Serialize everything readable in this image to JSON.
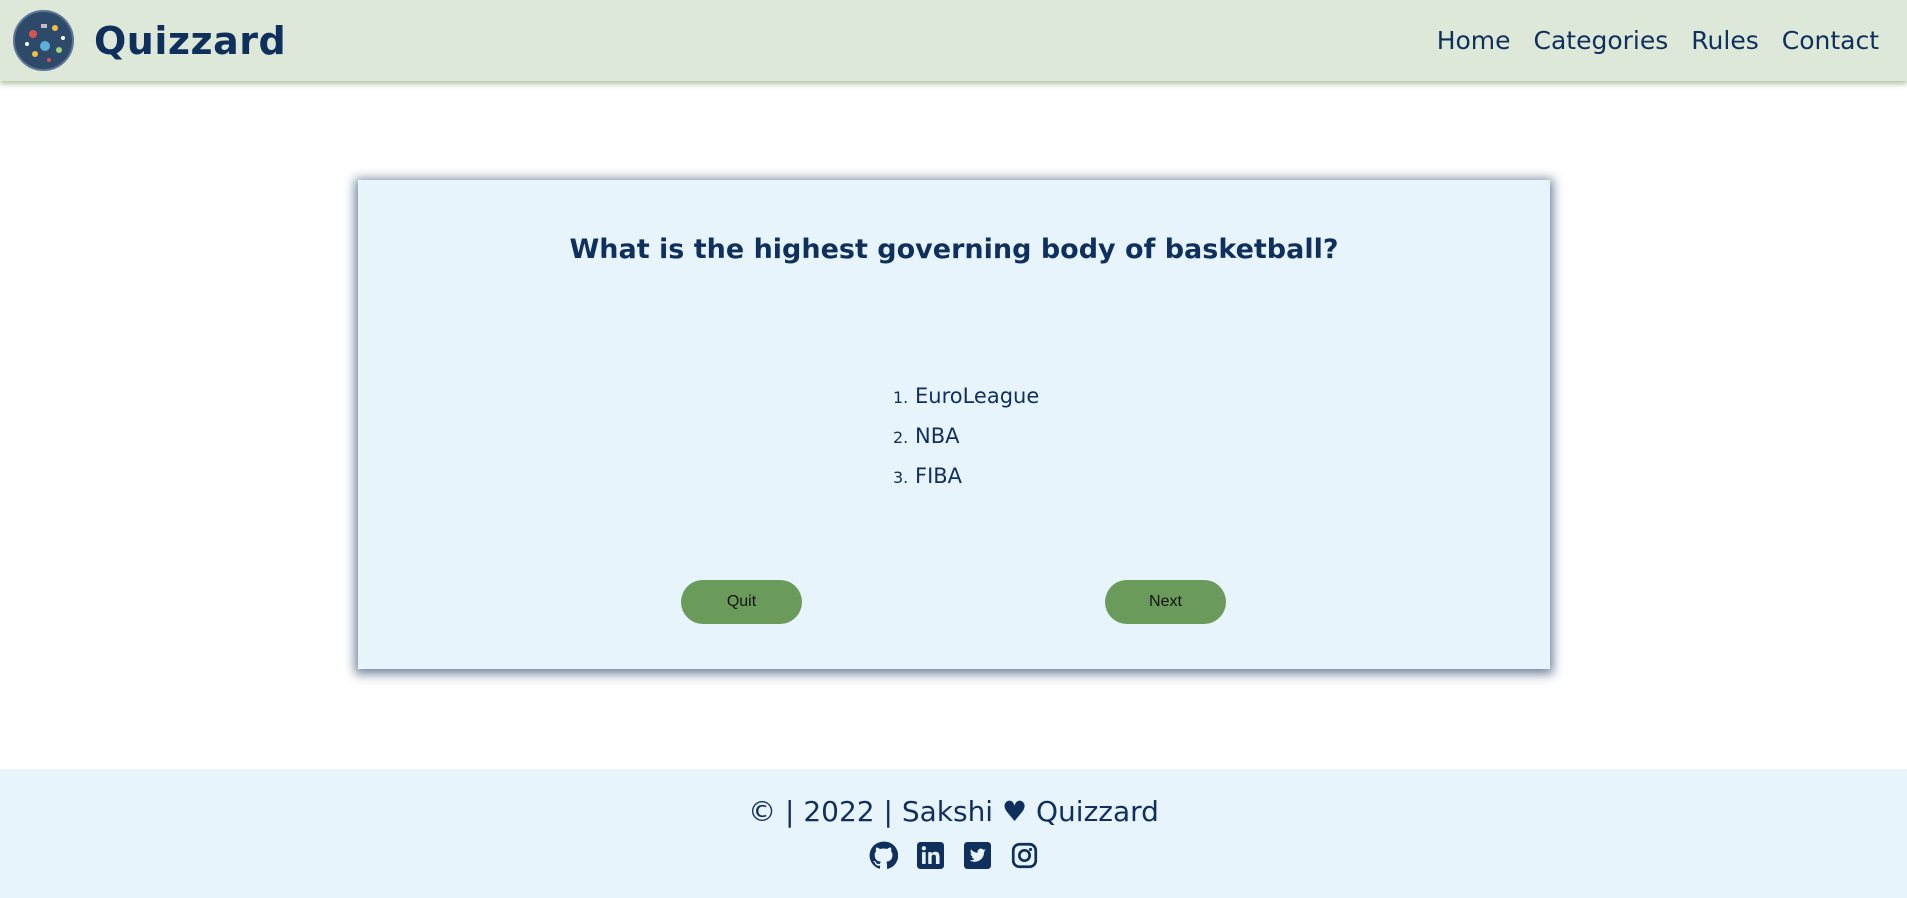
{
  "navbar": {
    "brand": "Quizzard",
    "links": [
      {
        "label": "Home"
      },
      {
        "label": "Categories"
      },
      {
        "label": "Rules"
      },
      {
        "label": "Contact"
      }
    ]
  },
  "quiz": {
    "question": "What is the highest governing body of basketball?",
    "options": [
      {
        "number": "1.",
        "label": "EuroLeague"
      },
      {
        "number": "2.",
        "label": "NBA"
      },
      {
        "number": "3.",
        "label": "FIBA"
      }
    ],
    "quit_label": "Quit",
    "next_label": "Next"
  },
  "footer": {
    "copyright": "©",
    "year": "2022",
    "author": "Sakshi",
    "heart": "♥",
    "brand": "Quizzard",
    "socials": [
      "github-icon",
      "linkedin-icon",
      "twitter-icon",
      "instagram-icon"
    ]
  },
  "colors": {
    "navbar_bg": "#dde8d8",
    "primary_text": "#0f2f5c",
    "card_bg": "#e8f4fc",
    "button_bg": "#6b9b5a"
  }
}
